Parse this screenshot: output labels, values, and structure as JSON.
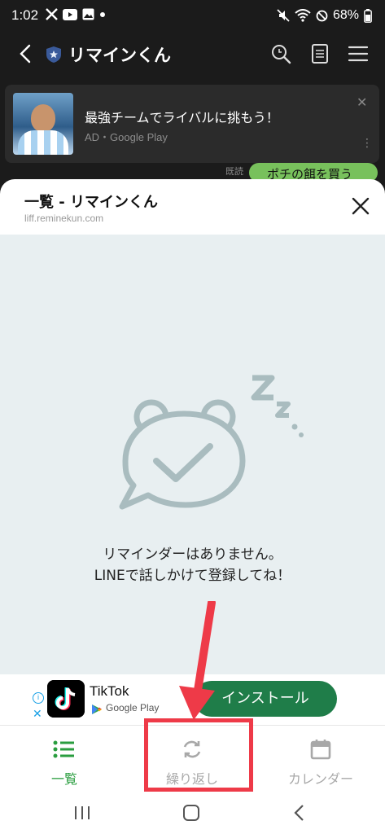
{
  "status_bar": {
    "time": "1:02",
    "battery": "68%"
  },
  "header": {
    "title": "リマインくん"
  },
  "chat_ad": {
    "title": "最強チームでライバルに挑もう！",
    "subtitle": "AD・Google Play"
  },
  "chat": {
    "read_label": "既読",
    "bubble_text": "ポチの餌を買う"
  },
  "sheet": {
    "title": "一覧 - リマインくん",
    "url": "liff.reminekun.com",
    "empty_line1": "リマインダーはありません。",
    "empty_line2": "LINEで話しかけて登録してね！"
  },
  "bottom_ad": {
    "app_name": "TikTok",
    "store_label": "Google Play",
    "install_label": "インストール"
  },
  "tabs": [
    {
      "label": "一覧"
    },
    {
      "label": "繰り返し"
    },
    {
      "label": "カレンダー"
    }
  ],
  "colors": {
    "accent_green": "#2a9d3f",
    "install_green": "#1f7d49",
    "annotation_red": "#ee3a48"
  }
}
